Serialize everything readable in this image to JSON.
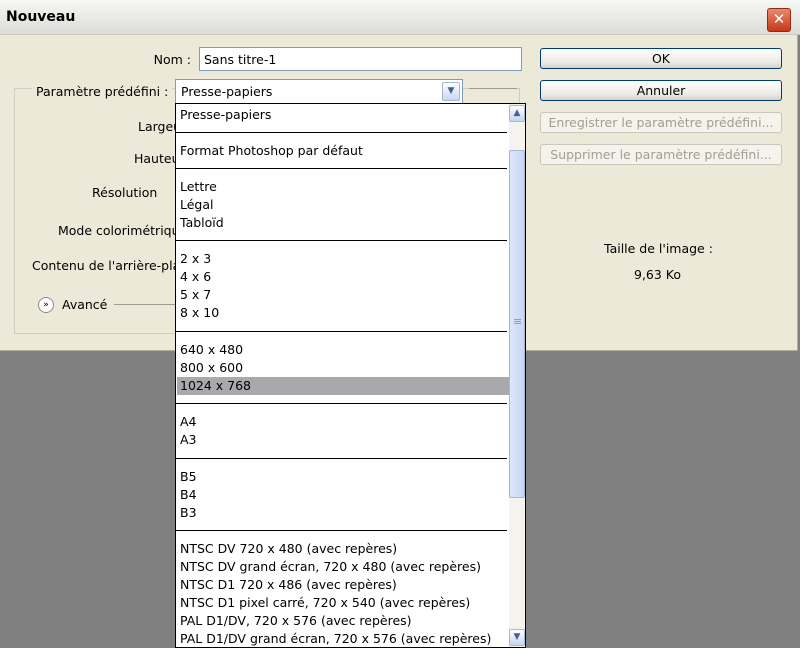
{
  "window": {
    "title": "Nouveau",
    "close_icon": "close-icon"
  },
  "form": {
    "nom_label": "Nom :",
    "nom_value": "Sans titre-1",
    "preset_label": "Paramètre prédéfini :",
    "preset_value": "Presse-papiers",
    "largeur_label": "Largeur",
    "hauteur_label": "Hauteur",
    "resolution_label": "Résolution",
    "mode_label": "Mode colorimétrique",
    "contenu_label": "Contenu de l'arrière-plan",
    "avance_label": "Avancé"
  },
  "buttons": {
    "ok": "OK",
    "annuler": "Annuler",
    "enregistrer": "Enregistrer le paramètre prédéfini...",
    "supprimer": "Supprimer le paramètre prédéfini..."
  },
  "image_size": {
    "label": "Taille de l'image :",
    "value": "9,63 Ko"
  },
  "dropdown": {
    "selected": "1024 x 768",
    "groups": [
      [
        "Presse-papiers"
      ],
      [
        "Format Photoshop par défaut"
      ],
      [
        "Lettre",
        "Légal",
        "Tabloïd"
      ],
      [
        "2 x 3",
        "4 x 6",
        "5 x 7",
        "8 x 10"
      ],
      [
        "640 x 480",
        "800 x 600",
        "1024 x 768"
      ],
      [
        "A4",
        "A3"
      ],
      [
        "B5",
        "B4",
        "B3"
      ],
      [
        "NTSC DV 720 x 480 (avec repères)",
        "NTSC DV grand écran, 720 x 480 (avec repères)",
        "NTSC D1 720 x 486 (avec repères)",
        "NTSC D1 pixel carré, 720 x 540 (avec repères)",
        "PAL D1/DV, 720 x 576 (avec repères)",
        "PAL D1/DV grand écran, 720 x 576 (avec repères)"
      ]
    ]
  }
}
